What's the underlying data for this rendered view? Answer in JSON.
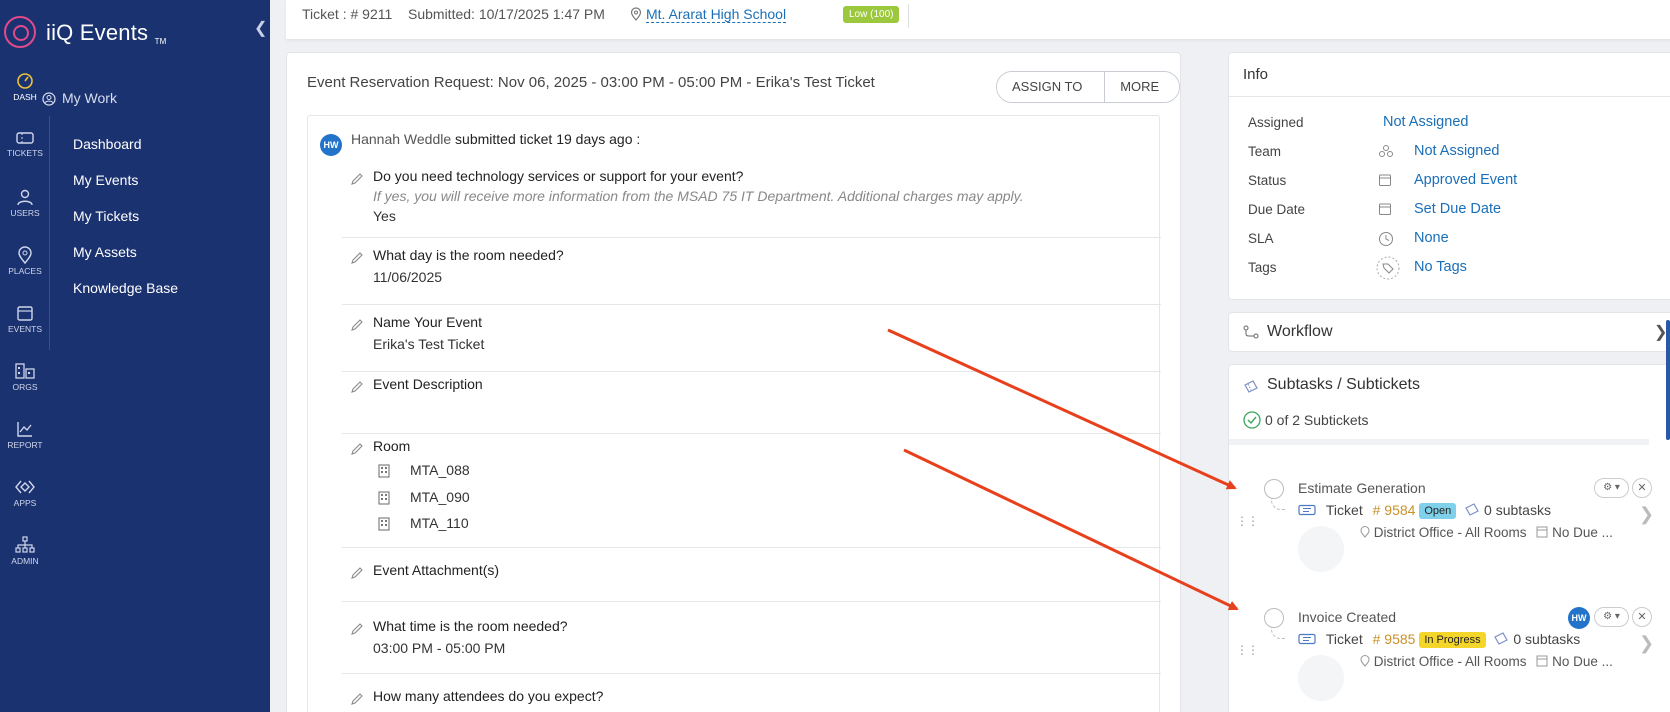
{
  "brand": {
    "name": "iiQ Events",
    "tm": "TM"
  },
  "rail": [
    {
      "label": "DASH",
      "icon": "dashboard-icon"
    },
    {
      "label": "TICKETS",
      "icon": "ticket-icon"
    },
    {
      "label": "USERS",
      "icon": "user-icon"
    },
    {
      "label": "PLACES",
      "icon": "location-pin-icon"
    },
    {
      "label": "EVENTS",
      "icon": "calendar-icon"
    },
    {
      "label": "ORGS",
      "icon": "building-icon"
    },
    {
      "label": "REPORT",
      "icon": "chart-icon"
    },
    {
      "label": "APPS",
      "icon": "apps-icon"
    },
    {
      "label": "ADMIN",
      "icon": "org-chart-icon"
    }
  ],
  "nav": {
    "my_work": "My Work",
    "items": [
      "Dashboard",
      "My Events",
      "My Tickets",
      "My Assets",
      "Knowledge Base"
    ]
  },
  "topbar": {
    "ticket": "Ticket : # 9211",
    "submitted": "Submitted: 10/17/2025 1:47 PM",
    "location": "Mt. Ararat High School",
    "priority": "Low (100)"
  },
  "main": {
    "title": "Event Reservation Request: Nov 06, 2025 - 03:00 PM - 05:00 PM - Erika's Test Ticket",
    "assign_label": "ASSIGN TO ME",
    "more_label": "MORE",
    "submitter_initials": "HW",
    "submitter_name": "Hannah Weddle",
    "submitted_text": "submitted ticket 19 days ago :",
    "questions": [
      {
        "label": "Do you need technology services or support for your event?",
        "hint": "If yes, you will receive more information from the MSAD 75 IT Department. Additional charges may apply.",
        "answer": "Yes"
      },
      {
        "label": "What day is the room needed?",
        "answer": "11/06/2025"
      },
      {
        "label": "Name Your Event",
        "answer": "Erika's Test Ticket"
      },
      {
        "label": "Event Description",
        "answer": ""
      },
      {
        "label": "Room",
        "rooms": [
          "MTA_088",
          "MTA_090",
          "MTA_110"
        ]
      },
      {
        "label": "Event Attachment(s)",
        "answer": ""
      },
      {
        "label": "What time is the room needed?",
        "answer": "03:00 PM - 05:00 PM"
      },
      {
        "label": "How many attendees do you expect?",
        "answer": ""
      }
    ]
  },
  "info": {
    "title": "Info",
    "rows": [
      {
        "label": "Assigned",
        "value": "Not Assigned"
      },
      {
        "label": "Team",
        "value": "Not Assigned",
        "icon": "team-icon"
      },
      {
        "label": "Status",
        "value": "Approved Event",
        "icon": "calendar-icon"
      },
      {
        "label": "Due Date",
        "value": "Set Due Date",
        "icon": "calendar-icon"
      },
      {
        "label": "SLA",
        "value": "None",
        "icon": "clock-icon"
      },
      {
        "label": "Tags",
        "value": "No Tags",
        "icon": "tag-icon"
      }
    ]
  },
  "workflow": {
    "title": "Workflow"
  },
  "subtasks": {
    "title": "Subtasks / Subtickets",
    "count": "0 of 2 Subtickets",
    "items": [
      {
        "title": "Estimate Generation",
        "type": "Ticket",
        "number": "# 9584",
        "status": "Open",
        "subtasks": "0 subtasks",
        "location": "District Office - All Rooms",
        "due": "No Due ...",
        "assignee": ""
      },
      {
        "title": "Invoice Created",
        "type": "Ticket",
        "number": "# 9585",
        "status": "In Progress",
        "subtasks": "0 subtasks",
        "location": "District Office - All Rooms",
        "due": "No Due ...",
        "assignee": "HW"
      }
    ]
  },
  "colors": {
    "sidebar": "#1b3270",
    "link": "#1b6fb8",
    "accent_pink": "#e24a8a",
    "arrow": "#e8401c",
    "open": "#7fd0ea",
    "in_progress": "#f4d52a",
    "low": "#9bc83d"
  }
}
